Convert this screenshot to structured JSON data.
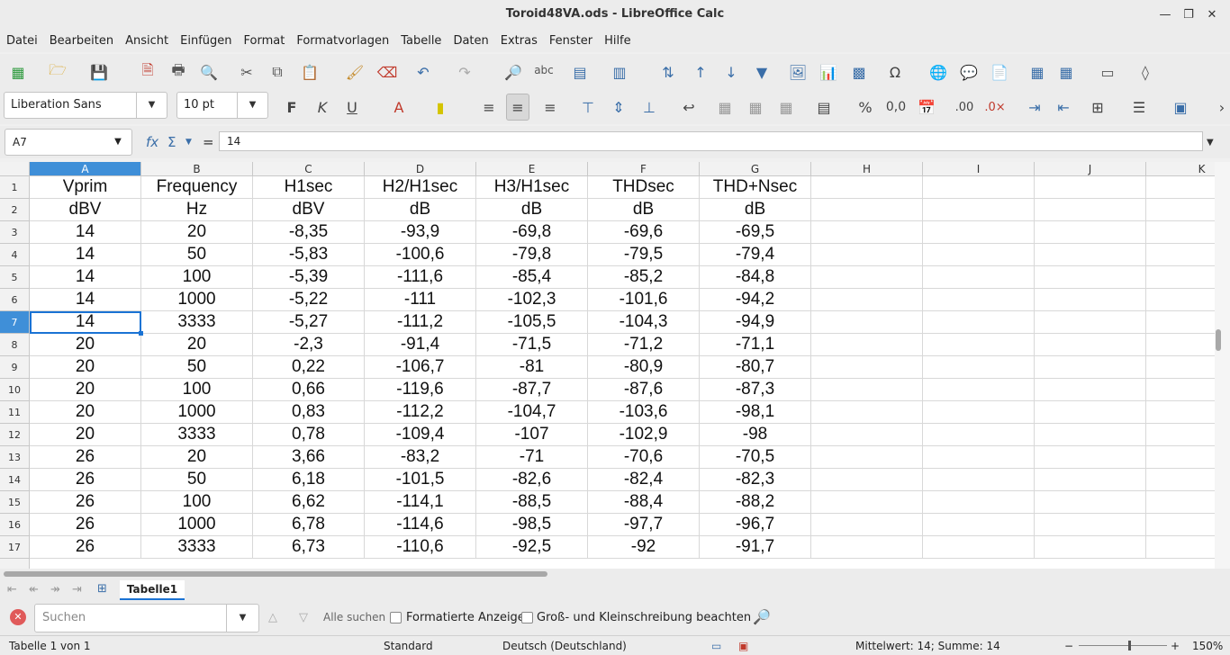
{
  "window": {
    "title": "Toroid48VA.ods - LibreOffice Calc"
  },
  "menu": [
    "Datei",
    "Bearbeiten",
    "Ansicht",
    "Einfügen",
    "Format",
    "Formatvorlagen",
    "Tabelle",
    "Daten",
    "Extras",
    "Fenster",
    "Hilfe"
  ],
  "format": {
    "font_name": "Liberation Sans",
    "font_size": "10 pt"
  },
  "formula": {
    "cell_ref": "A7",
    "content": "14"
  },
  "columns": [
    "A",
    "B",
    "C",
    "D",
    "E",
    "F",
    "G",
    "H",
    "I",
    "J",
    "K"
  ],
  "rows": [
    [
      "1",
      "Vprim",
      "Frequency",
      "H1sec",
      "H2/H1sec",
      "H3/H1sec",
      "THDsec",
      "THD+Nsec"
    ],
    [
      "2",
      "dBV",
      "Hz",
      "dBV",
      "dB",
      "dB",
      "dB",
      "dB"
    ],
    [
      "3",
      "14",
      "20",
      "-8,35",
      "-93,9",
      "-69,8",
      "-69,6",
      "-69,5"
    ],
    [
      "4",
      "14",
      "50",
      "-5,83",
      "-100,6",
      "-79,8",
      "-79,5",
      "-79,4"
    ],
    [
      "5",
      "14",
      "100",
      "-5,39",
      "-111,6",
      "-85,4",
      "-85,2",
      "-84,8"
    ],
    [
      "6",
      "14",
      "1000",
      "-5,22",
      "-111",
      "-102,3",
      "-101,6",
      "-94,2"
    ],
    [
      "7",
      "14",
      "3333",
      "-5,27",
      "-111,2",
      "-105,5",
      "-104,3",
      "-94,9"
    ],
    [
      "8",
      "20",
      "20",
      "-2,3",
      "-91,4",
      "-71,5",
      "-71,2",
      "-71,1"
    ],
    [
      "9",
      "20",
      "50",
      "0,22",
      "-106,7",
      "-81",
      "-80,9",
      "-80,7"
    ],
    [
      "10",
      "20",
      "100",
      "0,66",
      "-119,6",
      "-87,7",
      "-87,6",
      "-87,3"
    ],
    [
      "11",
      "20",
      "1000",
      "0,83",
      "-112,2",
      "-104,7",
      "-103,6",
      "-98,1"
    ],
    [
      "12",
      "20",
      "3333",
      "0,78",
      "-109,4",
      "-107",
      "-102,9",
      "-98"
    ],
    [
      "13",
      "26",
      "20",
      "3,66",
      "-83,2",
      "-71",
      "-70,6",
      "-70,5"
    ],
    [
      "14",
      "26",
      "50",
      "6,18",
      "-101,5",
      "-82,6",
      "-82,4",
      "-82,3"
    ],
    [
      "15",
      "26",
      "100",
      "6,62",
      "-114,1",
      "-88,5",
      "-88,4",
      "-88,2"
    ],
    [
      "16",
      "26",
      "1000",
      "6,78",
      "-114,6",
      "-98,5",
      "-97,7",
      "-96,7"
    ],
    [
      "17",
      "26",
      "3333",
      "6,73",
      "-110,6",
      "-92,5",
      "-92",
      "-91,7"
    ]
  ],
  "sheet": {
    "tab_label": "Tabelle1"
  },
  "find": {
    "placeholder": "Suchen",
    "find_all": "Alle suchen",
    "formatted_display": "Formatierte Anzeige",
    "match_case": "Groß- und Kleinschreibung beachten"
  },
  "status": {
    "sheet_info": "Tabelle 1 von 1",
    "style": "Standard",
    "language": "Deutsch (Deutschland)",
    "summary": "Mittelwert: 14; Summe: 14",
    "zoom": "150%"
  },
  "colors": {
    "selection": "#3f8fd8",
    "cursor": "#1a73d4"
  }
}
